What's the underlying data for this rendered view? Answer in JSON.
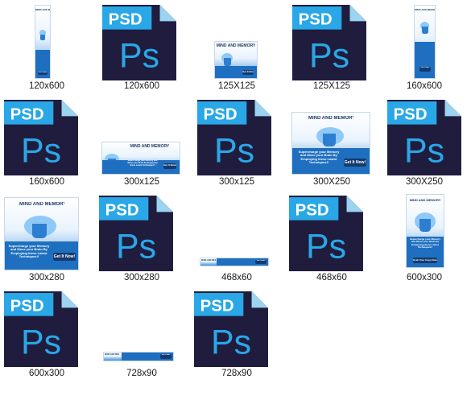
{
  "files": [
    {
      "label": "120x600",
      "kind": "image"
    },
    {
      "label": "120x600",
      "kind": "psd"
    },
    {
      "label": "125X125",
      "kind": "image"
    },
    {
      "label": "125X125",
      "kind": "psd"
    },
    {
      "label": "160x600",
      "kind": "image"
    },
    {
      "label": "160x600",
      "kind": "psd"
    },
    {
      "label": "300x125",
      "kind": "image"
    },
    {
      "label": "300x125",
      "kind": "psd"
    },
    {
      "label": "300X250",
      "kind": "image"
    },
    {
      "label": "300X250",
      "kind": "psd"
    },
    {
      "label": "300x280",
      "kind": "image"
    },
    {
      "label": "300x280",
      "kind": "psd"
    },
    {
      "label": "468x60",
      "kind": "image"
    },
    {
      "label": "468x60",
      "kind": "psd"
    },
    {
      "label": "600x300",
      "kind": "image"
    },
    {
      "label": "600x300",
      "kind": "psd"
    },
    {
      "label": "728x90",
      "kind": "image"
    },
    {
      "label": "728x90",
      "kind": "psd"
    }
  ],
  "psd_icon": {
    "badge": "PSD",
    "mark": "Ps",
    "body_color": "#1f1c3d",
    "badge_color": "#2aa7e6",
    "mark_color": "#2aa7e6",
    "fold_color": "#9bd3f0"
  },
  "ad": {
    "brand": "MIND AND MEMORY",
    "brand_sub": "MASTERY",
    "headline": "Supercharge your Memory and Move your Brain By Employing these Latest Techniques!!",
    "cta": "Get It Now!",
    "cta_alt": "Grab Your Copy Now!",
    "primary_color": "#1f6fc0",
    "dark_color": "#153b6e"
  }
}
